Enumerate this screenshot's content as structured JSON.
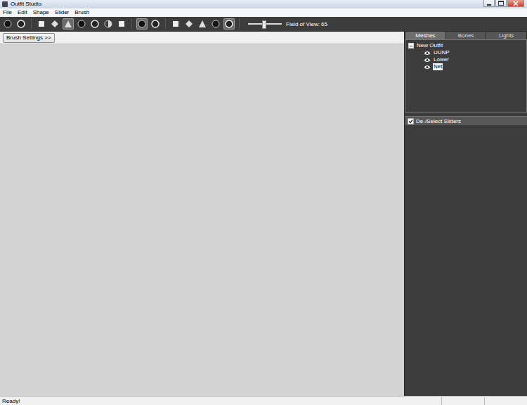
{
  "window": {
    "title": "Outfit Studio"
  },
  "menu": [
    "File",
    "Edit",
    "Shape",
    "Slider",
    "Brush"
  ],
  "toolbar": {
    "groups": [
      [
        {
          "selected": false
        },
        {
          "selected": false
        }
      ],
      [
        {
          "selected": false
        },
        {
          "selected": false
        },
        {
          "selected": true
        },
        {
          "selected": false
        },
        {
          "selected": false
        },
        {
          "selected": false
        },
        {
          "selected": false
        }
      ],
      [
        {
          "selected": true
        },
        {
          "selected": false
        }
      ],
      [
        {
          "selected": false
        },
        {
          "selected": false
        },
        {
          "selected": false
        },
        {
          "selected": false
        },
        {
          "selected": true
        }
      ]
    ],
    "fov_slider": {
      "level": 0.45
    },
    "fov_label": "Field of View: 65"
  },
  "brush_settings_button": "Brush Settings >>",
  "tabs": [
    {
      "label": "Meshes",
      "selected": true
    },
    {
      "label": "Bones",
      "selected": false
    },
    {
      "label": "Lights",
      "selected": false
    }
  ],
  "tree": {
    "root": {
      "label": "New Outfit",
      "expanded": true
    },
    "items": [
      {
        "label": "UUNP",
        "visible": true,
        "selected": false
      },
      {
        "label": "Lower",
        "visible": true,
        "selected": false
      },
      {
        "label": "Net",
        "visible": true,
        "selected": true
      }
    ]
  },
  "sliders_header": {
    "label": "De-/Select Sliders",
    "checked": true
  },
  "status_bar": "Ready!"
}
